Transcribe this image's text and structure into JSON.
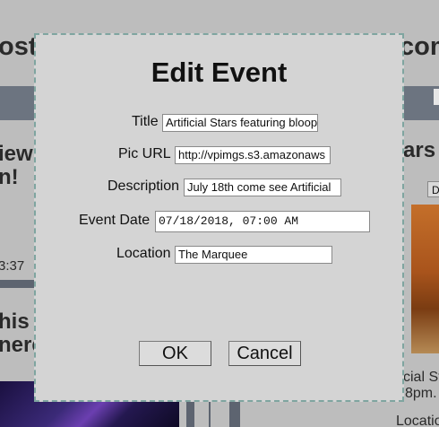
{
  "background": {
    "left_heading_1": "ost",
    "right_heading_1": "com",
    "left_heading_2": "iew",
    "left_heading_3": "n!",
    "left_time": "3:37",
    "left_heading_4": "his",
    "left_heading_5": "nere",
    "right_heading_2": "ars",
    "right_button": "D",
    "right_text_1": "cial St",
    "right_text_2": "8pm.",
    "right_text_3": "Locatio"
  },
  "dialog": {
    "title": "Edit Event",
    "fields": {
      "title_label": "Title",
      "title_value": "Artificial Stars featuring bloop",
      "pic_url_label": "Pic URL",
      "pic_url_value": "http://vpimgs.s3.amazonaws",
      "description_label": "Description",
      "description_value": "July 18th come see Artificial",
      "event_date_label": "Event Date",
      "event_date_value": "07/18/2018, 07:00 AM",
      "location_label": "Location",
      "location_value": "The Marquee"
    },
    "ok_label": "OK",
    "cancel_label": "Cancel"
  }
}
